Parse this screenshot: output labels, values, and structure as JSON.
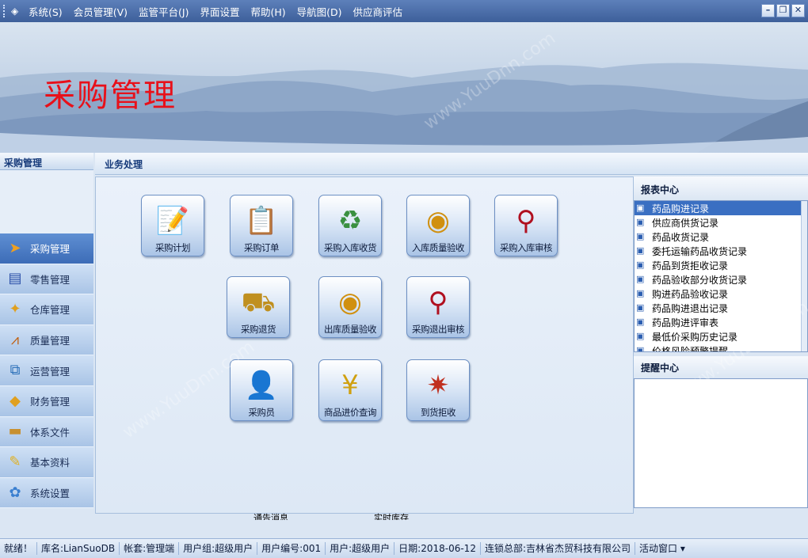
{
  "menu": {
    "items": [
      "系统(S)",
      "会员管理(V)",
      "监管平台(J)",
      "界面设置",
      "帮助(H)",
      "导航图(D)",
      "供应商评估"
    ]
  },
  "window_buttons": {
    "min": "–",
    "restore": "❐",
    "close": "✕"
  },
  "banner": {
    "title": "采购管理"
  },
  "left": {
    "header": "采购管理",
    "nav": [
      {
        "label": "采购管理",
        "icon": "arrow-icon"
      },
      {
        "label": "零售管理",
        "icon": "book-icon"
      },
      {
        "label": "仓库管理",
        "icon": "warehouse-icon"
      },
      {
        "label": "质量管理",
        "icon": "compass-icon"
      },
      {
        "label": "运营管理",
        "icon": "network-icon"
      },
      {
        "label": "财务管理",
        "icon": "finance-icon"
      },
      {
        "label": "体系文件",
        "icon": "folder-icon"
      },
      {
        "label": "基本资料",
        "icon": "pencil-icon"
      },
      {
        "label": "系统设置",
        "icon": "settings-icon"
      }
    ]
  },
  "main": {
    "header": "业务处理",
    "tiles": [
      {
        "label": "采购计划",
        "icon": "plan-icon"
      },
      {
        "label": "采购订单",
        "icon": "order-icon"
      },
      {
        "label": "采购入库收货",
        "icon": "receive-icon"
      },
      {
        "label": "入库质量验收",
        "icon": "coins-icon"
      },
      {
        "label": "采购入库审核",
        "icon": "audit-icon"
      },
      {
        "label": "采购退货",
        "icon": "truck-icon"
      },
      {
        "label": "出库质量验收",
        "icon": "coins-icon"
      },
      {
        "label": "采购退出审核",
        "icon": "audit-icon"
      },
      {
        "label": "采购员",
        "icon": "buyer-icon"
      },
      {
        "label": "商品进价查询",
        "icon": "price-icon"
      },
      {
        "label": "到货拒收",
        "icon": "wand-icon"
      }
    ],
    "bottom_links": [
      "通告消息",
      "实时库存"
    ]
  },
  "report_center": {
    "title": "报表中心",
    "items": [
      "药品购进记录",
      "供应商供货记录",
      "药品收货记录",
      "委托运输药品收货记录",
      "药品到货拒收记录",
      "药品验收部分收货记录",
      "购进药品验收记录",
      "药品购进退出记录",
      "药品购进评审表",
      "最低价采购历史记录",
      "价格风险预警提醒"
    ]
  },
  "remind_center": {
    "title": "提醒中心"
  },
  "statusbar": [
    "就绪！",
    "库名:LianSuoDB",
    "帐套:管理端",
    "用户组:超级用户",
    "用户编号:001",
    "用户:超级用户",
    "日期:2018-06-12",
    "连锁总部:吉林省杰贸科技有限公司",
    "活动窗口 ▾"
  ],
  "watermark": "www.YuuDnn.com"
}
